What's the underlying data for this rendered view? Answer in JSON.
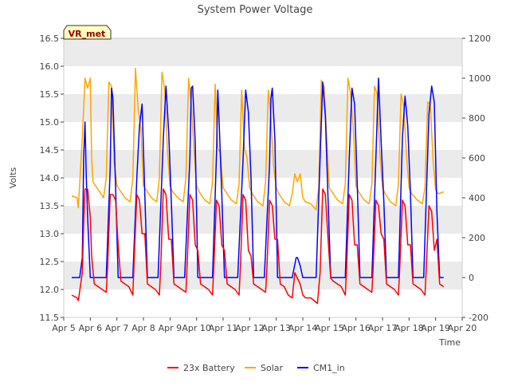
{
  "chart_data": {
    "type": "line",
    "title": "System Power Voltage",
    "xlabel": "Time",
    "ylabel": "Volts",
    "site_badge": "VR_met",
    "x_ticks": [
      "Apr 5",
      "Apr 6",
      "Apr 7",
      "Apr 8",
      "Apr 9",
      "Apr 10",
      "Apr 11",
      "Apr 12",
      "Apr 13",
      "Apr 14",
      "Apr 15",
      "Apr 16",
      "Apr 17",
      "Apr 18",
      "Apr 19",
      "Apr 20"
    ],
    "xlim": [
      0,
      15
    ],
    "ylim": [
      11.5,
      16.5
    ],
    "y_ticks": [
      "11.5",
      "12.0",
      "12.5",
      "13.0",
      "13.5",
      "14.0",
      "14.5",
      "15.0",
      "15.5",
      "16.0",
      "16.5"
    ],
    "y2lim": [
      -200,
      1200
    ],
    "y2_ticks": [
      "-200",
      "0",
      "200",
      "400",
      "600",
      "800",
      "1000",
      "1200"
    ],
    "grid": "horizontal bands",
    "legend_position": "bottom-center",
    "colors": {
      "battery": "#ff0000",
      "solar": "#ffa500",
      "cm1": "#0000ff",
      "band": "#ebebeb"
    },
    "series": [
      {
        "name": "23x Battery",
        "axis": "left",
        "color": "#ff0000",
        "x": [
          0.3,
          0.5,
          0.55,
          0.7,
          0.75,
          0.8,
          0.9,
          1.0,
          1.05,
          1.15,
          1.3,
          1.45,
          1.6,
          1.65,
          1.75,
          1.85,
          1.95,
          2.05,
          2.15,
          2.3,
          2.45,
          2.6,
          2.65,
          2.75,
          2.85,
          2.95,
          3.05,
          3.15,
          3.3,
          3.45,
          3.6,
          3.65,
          3.75,
          3.85,
          3.95,
          4.05,
          4.15,
          4.3,
          4.45,
          4.6,
          4.65,
          4.75,
          4.85,
          4.95,
          5.05,
          5.15,
          5.3,
          5.45,
          5.6,
          5.65,
          5.75,
          5.85,
          5.95,
          6.05,
          6.15,
          6.3,
          6.45,
          6.6,
          6.65,
          6.75,
          6.85,
          6.95,
          7.05,
          7.15,
          7.3,
          7.45,
          7.6,
          7.65,
          7.75,
          7.85,
          7.95,
          8.05,
          8.15,
          8.3,
          8.45,
          8.6,
          8.7,
          8.8,
          8.9,
          9.0,
          9.1,
          9.3,
          9.55,
          9.65,
          9.75,
          9.85,
          9.95,
          10.05,
          10.15,
          10.3,
          10.45,
          10.6,
          10.65,
          10.75,
          10.85,
          10.95,
          11.05,
          11.15,
          11.3,
          11.45,
          11.6,
          11.65,
          11.75,
          11.85,
          11.95,
          12.05,
          12.15,
          12.3,
          12.45,
          12.6,
          12.65,
          12.75,
          12.85,
          12.95,
          13.05,
          13.15,
          13.3,
          13.45,
          13.6,
          13.65,
          13.75,
          13.85,
          13.95,
          14.05,
          14.15,
          14.3
        ],
        "values": [
          11.9,
          11.85,
          11.8,
          12.3,
          13.2,
          13.8,
          13.8,
          13.3,
          12.6,
          12.1,
          12.05,
          12.0,
          11.95,
          12.4,
          13.7,
          13.7,
          13.6,
          12.8,
          12.15,
          12.1,
          12.05,
          11.9,
          12.5,
          13.7,
          13.6,
          13.0,
          13.0,
          12.1,
          12.05,
          12.0,
          11.9,
          12.4,
          13.8,
          13.7,
          12.9,
          12.9,
          12.1,
          12.05,
          12.0,
          11.95,
          12.5,
          13.7,
          13.6,
          12.8,
          12.7,
          12.1,
          12.05,
          12.0,
          11.9,
          12.4,
          13.6,
          13.5,
          12.8,
          12.7,
          12.1,
          12.05,
          12.0,
          11.9,
          12.4,
          13.7,
          13.6,
          12.7,
          12.6,
          12.1,
          12.05,
          12.0,
          11.95,
          12.4,
          13.6,
          13.5,
          12.9,
          12.9,
          12.1,
          12.05,
          11.9,
          11.85,
          12.3,
          12.2,
          12.1,
          11.9,
          11.85,
          11.85,
          11.75,
          12.3,
          13.8,
          13.7,
          12.9,
          12.2,
          12.15,
          12.1,
          12.05,
          11.9,
          12.4,
          13.7,
          13.6,
          12.8,
          12.8,
          12.1,
          12.05,
          12.0,
          11.95,
          12.4,
          13.6,
          13.5,
          13.0,
          12.9,
          12.1,
          12.05,
          12.0,
          11.9,
          12.4,
          13.6,
          13.5,
          12.8,
          12.8,
          12.1,
          12.05,
          12.0,
          11.9,
          12.4,
          13.5,
          13.4,
          12.7,
          12.9,
          12.1,
          12.05
        ]
      },
      {
        "name": "Solar",
        "axis": "right",
        "color": "#ffa500",
        "x": [
          0.3,
          0.5,
          0.55,
          0.7,
          0.8,
          0.9,
          1.0,
          1.05,
          1.1,
          1.3,
          1.5,
          1.6,
          1.7,
          1.8,
          1.9,
          2.0,
          2.1,
          2.3,
          2.5,
          2.6,
          2.7,
          2.8,
          2.9,
          3.0,
          3.1,
          3.3,
          3.5,
          3.6,
          3.7,
          3.8,
          3.9,
          4.0,
          4.1,
          4.3,
          4.5,
          4.6,
          4.7,
          4.8,
          4.9,
          5.0,
          5.1,
          5.3,
          5.5,
          5.6,
          5.7,
          5.8,
          5.9,
          6.0,
          6.1,
          6.3,
          6.5,
          6.6,
          6.7,
          6.8,
          6.9,
          7.0,
          7.1,
          7.3,
          7.5,
          7.6,
          7.7,
          7.8,
          7.9,
          8.0,
          8.1,
          8.3,
          8.5,
          8.6,
          8.7,
          8.8,
          8.9,
          9.0,
          9.1,
          9.3,
          9.5,
          9.6,
          9.7,
          9.8,
          9.9,
          10.0,
          10.1,
          10.3,
          10.5,
          10.6,
          10.7,
          10.8,
          10.9,
          11.0,
          11.1,
          11.3,
          11.5,
          11.6,
          11.7,
          11.8,
          11.9,
          12.0,
          12.1,
          12.3,
          12.5,
          12.6,
          12.7,
          12.8,
          12.9,
          13.0,
          13.1,
          13.3,
          13.5,
          13.6,
          13.7,
          13.8,
          13.9,
          14.0,
          14.1,
          14.3
        ],
        "values": [
          410,
          400,
          350,
          700,
          1000,
          950,
          1000,
          600,
          480,
          440,
          400,
          500,
          980,
          960,
          580,
          460,
          440,
          400,
          380,
          500,
          1050,
          850,
          750,
          460,
          440,
          400,
          380,
          500,
          1030,
          940,
          650,
          460,
          430,
          400,
          380,
          500,
          1000,
          870,
          650,
          460,
          430,
          390,
          370,
          480,
          970,
          650,
          620,
          450,
          430,
          390,
          370,
          470,
          940,
          650,
          600,
          450,
          420,
          380,
          360,
          480,
          940,
          800,
          560,
          450,
          420,
          380,
          360,
          420,
          520,
          480,
          520,
          400,
          380,
          370,
          340,
          450,
          990,
          960,
          700,
          450,
          430,
          390,
          370,
          470,
          1000,
          920,
          750,
          460,
          430,
          390,
          370,
          470,
          960,
          920,
          620,
          450,
          420,
          380,
          360,
          470,
          920,
          860,
          620,
          450,
          420,
          390,
          370,
          450,
          880,
          870,
          600,
          440,
          420,
          430
        ]
      },
      {
        "name": "CM1_in",
        "axis": "right",
        "color": "#0000ff",
        "x": [
          0.3,
          0.5,
          0.6,
          0.7,
          0.75,
          0.8,
          0.85,
          0.9,
          1.0,
          1.1,
          1.6,
          1.75,
          1.8,
          1.85,
          1.95,
          2.05,
          2.1,
          2.6,
          2.75,
          2.85,
          2.95,
          3.05,
          3.15,
          3.55,
          3.75,
          3.85,
          3.95,
          4.05,
          4.15,
          4.55,
          4.75,
          4.8,
          4.85,
          4.95,
          5.05,
          5.1,
          5.6,
          5.75,
          5.8,
          5.85,
          5.95,
          6.05,
          6.1,
          6.55,
          6.75,
          6.85,
          6.95,
          7.05,
          7.15,
          7.55,
          7.75,
          7.8,
          7.85,
          7.95,
          8.05,
          8.1,
          8.6,
          8.75,
          8.8,
          8.9,
          9.0,
          9.1,
          9.5,
          9.65,
          9.75,
          9.85,
          9.95,
          10.05,
          10.1,
          10.6,
          10.75,
          10.85,
          10.95,
          11.05,
          11.15,
          11.6,
          11.75,
          11.85,
          11.95,
          12.05,
          12.15,
          12.6,
          12.75,
          12.85,
          12.95,
          13.05,
          13.15,
          13.55,
          13.75,
          13.85,
          13.95,
          14.05,
          14.15,
          14.3
        ],
        "values": [
          0,
          0,
          0,
          100,
          600,
          780,
          500,
          300,
          0,
          0,
          0,
          550,
          950,
          900,
          460,
          0,
          0,
          0,
          500,
          760,
          870,
          420,
          0,
          0,
          700,
          960,
          730,
          380,
          0,
          0,
          600,
          950,
          960,
          680,
          0,
          0,
          0,
          620,
          940,
          780,
          420,
          0,
          0,
          0,
          590,
          940,
          830,
          500,
          0,
          0,
          570,
          900,
          950,
          690,
          0,
          0,
          0,
          100,
          100,
          60,
          0,
          0,
          0,
          600,
          980,
          810,
          390,
          0,
          0,
          0,
          600,
          950,
          870,
          470,
          0,
          0,
          600,
          1000,
          680,
          380,
          0,
          0,
          700,
          910,
          760,
          430,
          0,
          0,
          820,
          960,
          880,
          330,
          0,
          0
        ]
      }
    ]
  }
}
